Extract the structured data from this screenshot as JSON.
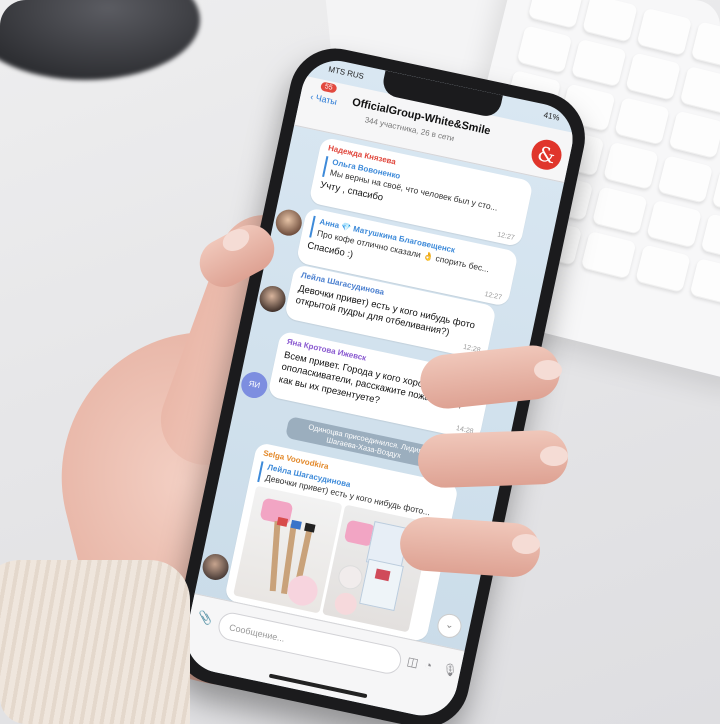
{
  "status_bar": {
    "carrier": "MTS RUS",
    "battery": "41%"
  },
  "header": {
    "back_label": "Чаты",
    "unread_badge": "55",
    "title": "OfficialGroup-White&Smile",
    "subtitle": "344 участника, 26 в сети",
    "group_avatar_letter": "&"
  },
  "messages": [
    {
      "sender": "Надежда Князева",
      "sender_color": "#e0473d",
      "reply_name": "Ольга Вовоненко",
      "reply_text": "Мы верны на своё, что человек был у сто...",
      "text": "Учту , спасибо",
      "time": "12:27"
    },
    {
      "sender": "",
      "reply_name": "Анна 💎 Матушкина Благовещенск",
      "reply_text": "Про кофе отлично сказали 👌 спорить бес...",
      "text": "Спасибо :)",
      "time": "12:27"
    },
    {
      "sender": "Лейла Шагасудинова",
      "sender_color": "#4a7fcf",
      "text": "Девочки привет) есть у кого нибудь фото открытой пудры для отбеливания?)",
      "time": "12:28"
    },
    {
      "sender": "Яна Кротова Ижевск",
      "sender_color": "#8a5ad0",
      "avatar_initials": "ЯИ",
      "text": "Всем привет. Города у кого хорошо идут ополаскиватели, расскажите пожалуйста, как вы их презентуете?",
      "time": "14:28"
    },
    {
      "sender": "Selga Voovodkira",
      "sender_color": "#e38a2c",
      "reply_name": "Лейла Шагасудинова",
      "reply_text": "Девочки привет) есть у кого нибудь фото...",
      "text": "",
      "time": ""
    }
  ],
  "service_message": "Одиноцва присоединился. Лидия Шагаева-Хаза-Воздух",
  "input": {
    "placeholder": "Сообщение..."
  },
  "colors": {
    "accent": "#2b7bd6",
    "group_avatar": "#e0352b",
    "chat_bg": "#d9e7f2"
  }
}
